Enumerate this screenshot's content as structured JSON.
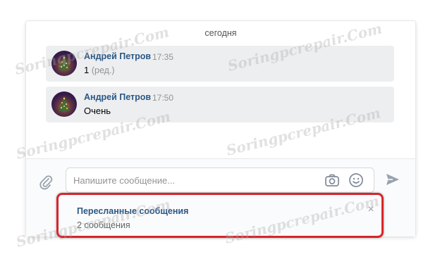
{
  "chat": {
    "date_divider": "сегодня",
    "messages": [
      {
        "author": "Андрей Петров",
        "time": "17:35",
        "text": "1",
        "edited": "(ред.)"
      },
      {
        "author": "Андрей Петров",
        "time": "17:50",
        "text": "Очень",
        "edited": ""
      }
    ]
  },
  "composer": {
    "placeholder": "Напишите сообщение...",
    "value": ""
  },
  "forwarded": {
    "title": "Пересланные сообщения",
    "count": "2 сообщения",
    "close": "×"
  },
  "watermark": "Soringpcrepair.Com",
  "colors": {
    "accent": "#2a5885",
    "bubble": "#edeef0",
    "highlight": "#d6262b",
    "icon": "#99a2ad"
  }
}
